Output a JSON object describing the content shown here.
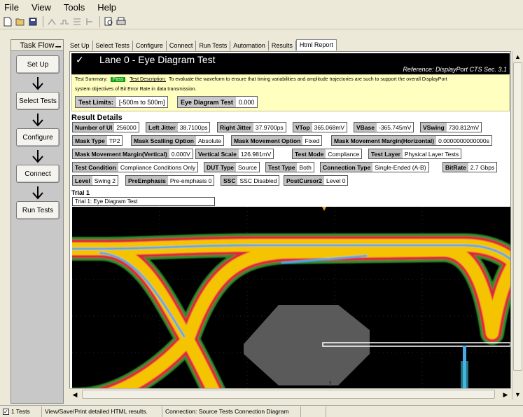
{
  "menu": [
    "File",
    "View",
    "Tools",
    "Help"
  ],
  "toolbar_icons": [
    "new-icon",
    "open-icon",
    "save-icon",
    "select-icon",
    "connect-icon",
    "run-icon",
    "pause-icon",
    "preview-icon",
    "print-icon"
  ],
  "task_flow": {
    "title": "Task Flow",
    "steps": [
      "Set Up",
      "Select Tests",
      "Configure",
      "Connect",
      "Run Tests"
    ]
  },
  "tabs": [
    "Set Up",
    "Select Tests",
    "Configure",
    "Connect",
    "Run Tests",
    "Automation",
    "Results",
    "Html Report"
  ],
  "active_tab": "Html Report",
  "report": {
    "title": "Lane 0 - Eye Diagram Test",
    "reference": "Reference: DisplayPort CTS Sec. 3.1",
    "summary_label": "Test Summary:",
    "summary_status": "Pass",
    "desc_label": "Test Description:",
    "desc_line1": "To evaluate the waveform to ensure that timing variabilities and amplitude trajectories are such to support the overall DisplayPort",
    "desc_line2": "system objectives of Bit Error Rate in data transmission.",
    "limits_label": "Test Limits:",
    "limits_value": "[-500m to 500m]",
    "result_label": "Eye Diagram Test",
    "result_value": "0.000",
    "details_title": "Result Details",
    "details": [
      [
        {
          "k": "Number of UI",
          "v": "256000"
        },
        {
          "k": "Left Jitter",
          "v": "38.7100ps"
        },
        {
          "k": "Right Jitter",
          "v": "37.9700ps"
        },
        {
          "k": "VTop",
          "v": "365.068mV"
        },
        {
          "k": "VBase",
          "v": "-365.745mV"
        },
        {
          "k": "VSwing",
          "v": "730.812mV"
        }
      ],
      [
        {
          "k": "Mask Type",
          "v": "TP2"
        },
        {
          "k": "Mask Scalling Option",
          "v": "Absolute"
        },
        {
          "k": "Mask Movement Option",
          "v": "Fixed"
        },
        {
          "k": "Mask Movement Margin(Horizontal)",
          "v": "0.0000000000000s"
        }
      ],
      [
        {
          "k": "Mask Movement Margin(Vertical)",
          "v": "0.000V"
        },
        {
          "k": "Vertical Scale",
          "v": "126.981mV"
        },
        {
          "k": "Test Mode",
          "v": "Compliance"
        },
        {
          "k": "Test Layer",
          "v": "Physical Layer Tests"
        }
      ],
      [
        {
          "k": "Test Condition",
          "v": "Compliance Conditions Only"
        },
        {
          "k": "DUT Type",
          "v": "Source"
        },
        {
          "k": "Test Type",
          "v": "Both"
        },
        {
          "k": "Connection Type",
          "v": "Single-Ended (A-B)"
        },
        {
          "k": "BitRate",
          "v": "2.7 Gbps"
        }
      ],
      [
        {
          "k": "Level",
          "v": "Swing 2"
        },
        {
          "k": "PreEmphasis",
          "v": "Pre-emphasis 0"
        },
        {
          "k": "SSC",
          "v": "SSC Disabled"
        },
        {
          "k": "PostCursor2",
          "v": "Level 0"
        }
      ]
    ],
    "trial_heading": "Trial 1",
    "trial_caption": "Trial 1: Eye Diagram Test",
    "plot_marker": "1"
  },
  "status": {
    "tests": "1 Tests",
    "message": "View/Save/Print detailed HTML results.",
    "connection": "Connection: Source Tests Connection Diagram"
  },
  "colors": {
    "pass": "#10a010",
    "summary_bg": "#ffffc0",
    "eye_outer": "#2e8b2e",
    "eye_mid": "#e0203a",
    "eye_hot": "#f5c400",
    "eye_core": "#4aa8e8",
    "mask": "#5a5a5a"
  }
}
